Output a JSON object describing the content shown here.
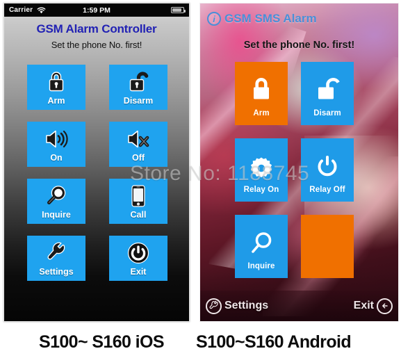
{
  "watermark": "Store No: 1188745",
  "colors": {
    "ios_button_blue": "#1fa3ef",
    "ios_title_blue": "#2222b4",
    "android_tile_blue": "#1f9be8",
    "android_tile_orange": "#f07000",
    "android_title_blue": "#4a8fd8"
  },
  "ios": {
    "statusbar": {
      "carrier": "Carrier",
      "wifi_icon": "wifi-icon",
      "time": "1:59 PM",
      "battery_icon": "battery-icon"
    },
    "title": "GSM Alarm Controller",
    "subtitle": "Set the phone No. first!",
    "buttons": [
      {
        "label": "Arm",
        "icon": "lock-closed-icon"
      },
      {
        "label": "Disarm",
        "icon": "lock-open-icon"
      },
      {
        "label": "On",
        "icon": "speaker-on-icon"
      },
      {
        "label": "Off",
        "icon": "speaker-mute-icon"
      },
      {
        "label": "Inquire",
        "icon": "magnifier-icon"
      },
      {
        "label": "Call",
        "icon": "phone-icon"
      },
      {
        "label": "Settings",
        "icon": "wrench-icon"
      },
      {
        "label": "Exit",
        "icon": "power-icon"
      }
    ],
    "caption": "S100~ S160 iOS"
  },
  "android": {
    "title": "GSM SMS Alarm",
    "title_icon": "info-circle-icon",
    "subtitle": "Set the phone No. first!",
    "tiles": [
      {
        "label": "Arm",
        "icon": "lock-closed-icon",
        "color": "#f07000"
      },
      {
        "label": "Disarm",
        "icon": "lock-open-icon",
        "color": "#1f9be8"
      },
      {
        "label": "Relay On",
        "icon": "gear-icon",
        "color": "#1f9be8"
      },
      {
        "label": "Relay Off",
        "icon": "power-icon",
        "color": "#1f9be8"
      },
      {
        "label": "Inquire",
        "icon": "magnifier-icon",
        "color": "#1f9be8"
      },
      {
        "label": "",
        "icon": "",
        "color": "#f07000"
      }
    ],
    "bottombar": {
      "settings_label": "Settings",
      "settings_icon": "wrench-circle-icon",
      "exit_label": "Exit",
      "exit_icon": "back-arrow-circle-icon"
    },
    "caption": "S100~S160 Android"
  }
}
